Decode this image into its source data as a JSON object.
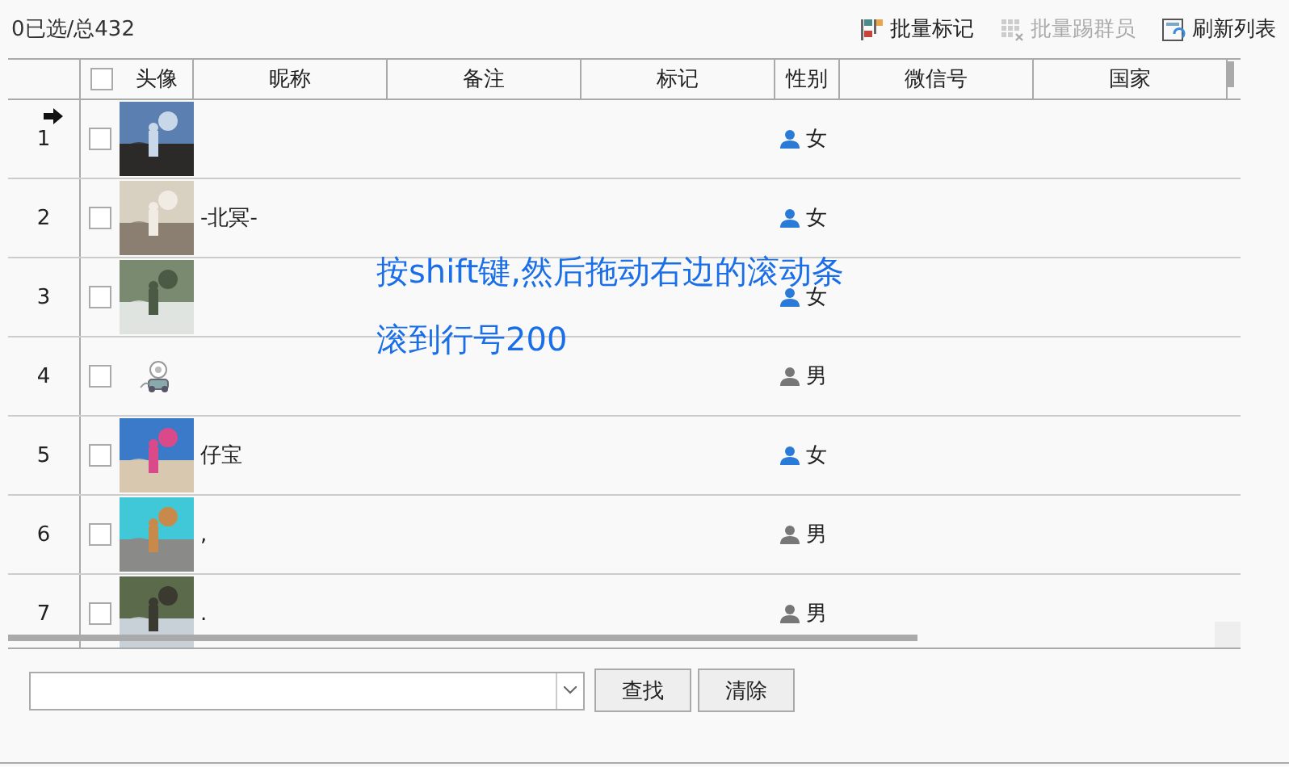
{
  "selection_count": "0已选/总432",
  "toolbar": [
    {
      "label": "批量标记",
      "kind": "flags",
      "disabled": false
    },
    {
      "label": "批量踢群员",
      "kind": "grid",
      "disabled": true
    },
    {
      "label": "刷新列表",
      "kind": "refresh",
      "disabled": false
    }
  ],
  "table": {
    "all_checked": false,
    "columns": [
      "头像",
      "昵称",
      "备注",
      "标记",
      "性别",
      "微信号",
      "国家"
    ],
    "rows": [
      {
        "number": "1",
        "current": true,
        "checked": false,
        "nickname": "",
        "gender": {
          "text": "女",
          "kind": "female"
        }
      },
      {
        "number": "2",
        "current": false,
        "checked": false,
        "nickname": "-北冥-",
        "gender": {
          "text": "女",
          "kind": "female"
        }
      },
      {
        "number": "3",
        "current": false,
        "checked": false,
        "nickname": "",
        "gender": {
          "text": "女",
          "kind": "female"
        }
      },
      {
        "number": "4",
        "current": false,
        "checked": false,
        "avatar": {
          "kind": "icon"
        },
        "nickname": "",
        "gender": {
          "text": "男",
          "kind": "male"
        }
      },
      {
        "number": "5",
        "current": false,
        "checked": false,
        "nickname": "仔宝",
        "gender": {
          "text": "女",
          "kind": "female"
        }
      },
      {
        "number": "6",
        "current": false,
        "checked": false,
        "nickname": ",",
        "gender": {
          "text": "男",
          "kind": "male"
        }
      },
      {
        "number": "7",
        "current": false,
        "checked": false,
        "nickname": ".",
        "gender": {
          "text": "男",
          "kind": "male"
        }
      }
    ]
  },
  "overlay_note": [
    "按shift键,然后拖动右边的滚动条",
    "滚到行号200"
  ],
  "search": {
    "buttons": [
      "查找",
      "清除"
    ]
  }
}
